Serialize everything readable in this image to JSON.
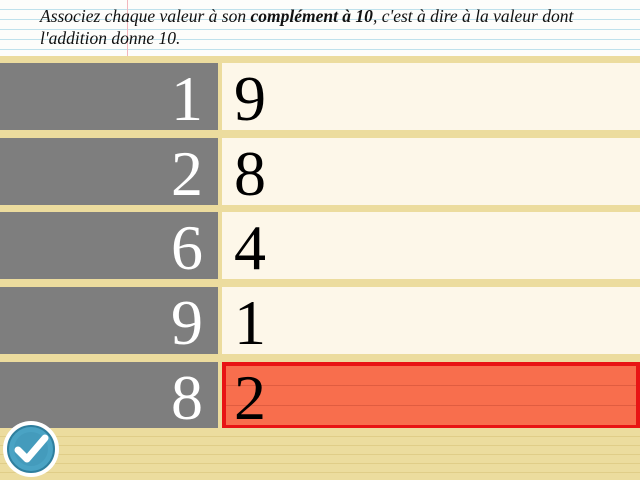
{
  "instruction": {
    "prefix": "Associez chaque valeur à son ",
    "bold": "complément à 10",
    "suffix": ", c'est à dire à la valeur dont l'addition donne 10."
  },
  "pairs": [
    {
      "left": "1",
      "right": "9",
      "selected": false
    },
    {
      "left": "2",
      "right": "8",
      "selected": false
    },
    {
      "left": "6",
      "right": "4",
      "selected": false
    },
    {
      "left": "9",
      "right": "1",
      "selected": false
    },
    {
      "left": "8",
      "right": "2",
      "selected": true
    }
  ],
  "colors": {
    "left_cell": "#7e7e7e",
    "right_cell": "#fdf7e9",
    "selected_fill": "#f86e4d",
    "selected_border": "#e81414",
    "check_button": "#4aa3c4"
  },
  "check_button": {
    "icon": "checkmark-icon"
  }
}
